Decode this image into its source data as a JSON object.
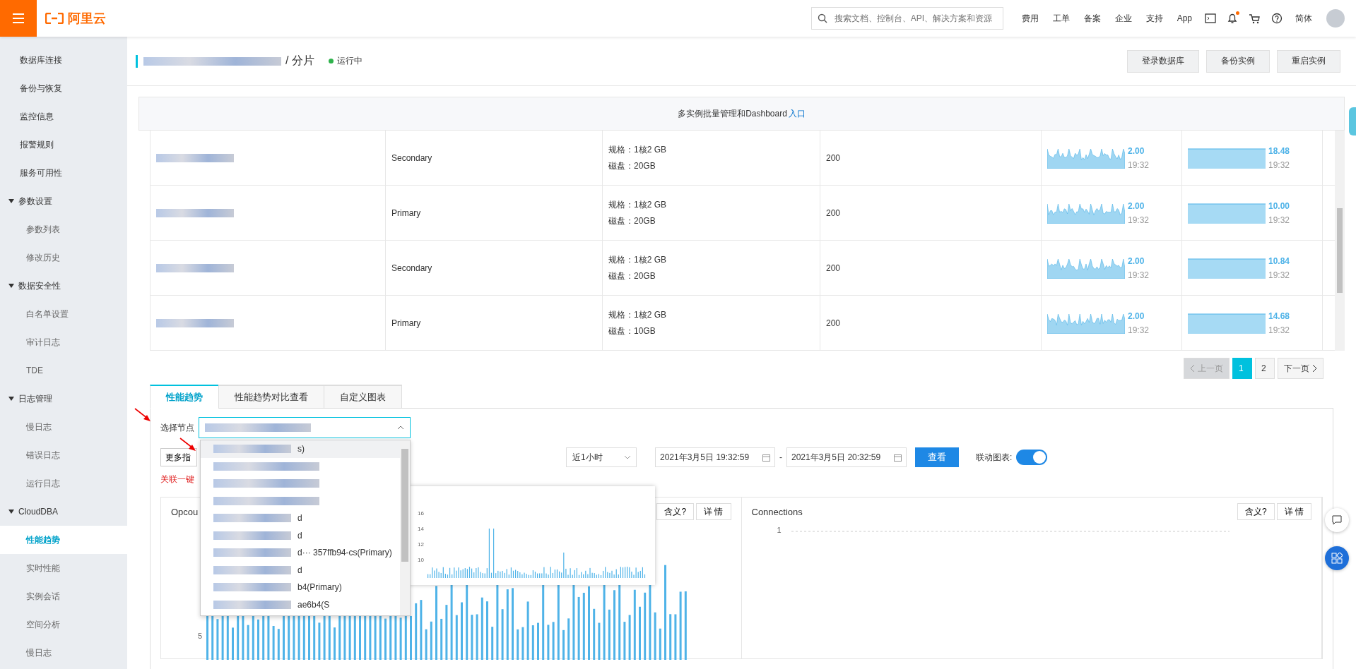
{
  "header": {
    "logo_text": "阿里云",
    "search_placeholder": "搜索文档、控制台、API、解决方案和资源",
    "nav": [
      "费用",
      "工单",
      "备案",
      "企业",
      "支持",
      "App"
    ],
    "notification_dot": true,
    "language": "简体"
  },
  "sidebar": {
    "items": [
      {
        "label": "数据库连接",
        "selected": false
      },
      {
        "label": "备份与恢复",
        "selected": false
      },
      {
        "label": "监控信息",
        "selected": false
      },
      {
        "label": "报警规则",
        "selected": false
      },
      {
        "label": "服务可用性",
        "selected": false
      },
      {
        "label": "参数设置",
        "expanded": true,
        "children": [
          {
            "label": "参数列表",
            "selected": false
          },
          {
            "label": "修改历史",
            "selected": false
          }
        ]
      },
      {
        "label": "数据安全性",
        "expanded": true,
        "children": [
          {
            "label": "白名单设置",
            "selected": false
          },
          {
            "label": "审计日志",
            "selected": false
          },
          {
            "label": "TDE",
            "selected": false
          }
        ]
      },
      {
        "label": "日志管理",
        "expanded": true,
        "children": [
          {
            "label": "慢日志",
            "selected": false
          },
          {
            "label": "错误日志",
            "selected": false
          },
          {
            "label": "运行日志",
            "selected": false
          }
        ]
      },
      {
        "label": "CloudDBA",
        "expanded": true,
        "children": [
          {
            "label": "性能趋势",
            "selected": true
          },
          {
            "label": "实时性能",
            "selected": false
          },
          {
            "label": "实例会话",
            "selected": false
          },
          {
            "label": "空间分析",
            "selected": false
          },
          {
            "label": "慢日志",
            "selected": false
          }
        ]
      }
    ]
  },
  "title": {
    "suffix": "/ 分片",
    "status": "运行中"
  },
  "actions": [
    "登录数据库",
    "备份实例",
    "重启实例"
  ],
  "notice": {
    "text": "多实例批量管理和Dashboard",
    "link": "入口"
  },
  "table": {
    "rows": [
      {
        "role": "Secondary",
        "spec": "规格：1核2 GB",
        "disk": "磁盘：20GB",
        "column_4": "200",
        "metric_1": "2.00",
        "time_1": "19:32",
        "metric_2": "18.48",
        "time_2": "19:32"
      },
      {
        "role": "Primary",
        "spec": "规格：1核2 GB",
        "disk": "磁盘：20GB",
        "column_4": "200",
        "metric_1": "2.00",
        "time_1": "19:32",
        "metric_2": "10.00",
        "time_2": "19:32"
      },
      {
        "role": "Secondary",
        "spec": "规格：1核2 GB",
        "disk": "磁盘：20GB",
        "column_4": "200",
        "metric_1": "2.00",
        "time_1": "19:32",
        "metric_2": "10.84",
        "time_2": "19:32"
      },
      {
        "role": "Primary",
        "spec": "规格：1核2 GB",
        "disk": "磁盘：10GB",
        "column_4": "200",
        "metric_1": "2.00",
        "time_1": "19:32",
        "metric_2": "14.68",
        "time_2": "19:32"
      }
    ]
  },
  "pagination": {
    "prev": "上一页",
    "prev_disabled": true,
    "pages": [
      {
        "label": "1",
        "selected": true
      },
      {
        "label": "2",
        "selected": false
      }
    ],
    "next": "下一页"
  },
  "tabs": [
    {
      "label": "性能趋势",
      "selected": true
    },
    {
      "label": "性能趋势对比查看",
      "selected": false
    },
    {
      "label": "自定义图表",
      "selected": false
    }
  ],
  "node_select": {
    "label": "选择节点",
    "expanded": true,
    "options": [
      {
        "text": "s)",
        "selected": true
      },
      {
        "selected": false
      },
      {
        "selected": false
      },
      {
        "selected": false
      },
      {
        "text": "d",
        "selected": false
      },
      {
        "text": "d",
        "selected": false
      },
      {
        "text": "d··· 357ffb94-cs(Primary)",
        "selected": false
      },
      {
        "text": "d",
        "selected": false
      },
      {
        "text": "b4(Primary)",
        "selected": false
      },
      {
        "text": "ae6b4(S",
        "selected": false
      }
    ]
  },
  "controls": {
    "more": "更多指",
    "range": "近1小时",
    "start": "2021年3月5日 19:32:59",
    "separator": "-",
    "end": "2021年3月5日 20:32:59",
    "query": "查看",
    "link_label": "联动图表:",
    "link_on": true
  },
  "diagnose_text": "关联一键",
  "charts": [
    {
      "title": "Opcou",
      "meaning": "含义?",
      "details": "详 情",
      "ytick": "5"
    },
    {
      "title": "Connections",
      "meaning": "含义?",
      "details": "详 情",
      "ytick": "1"
    }
  ],
  "popup_chart": {
    "yticks": [
      "16",
      "14",
      "12",
      "10"
    ]
  }
}
